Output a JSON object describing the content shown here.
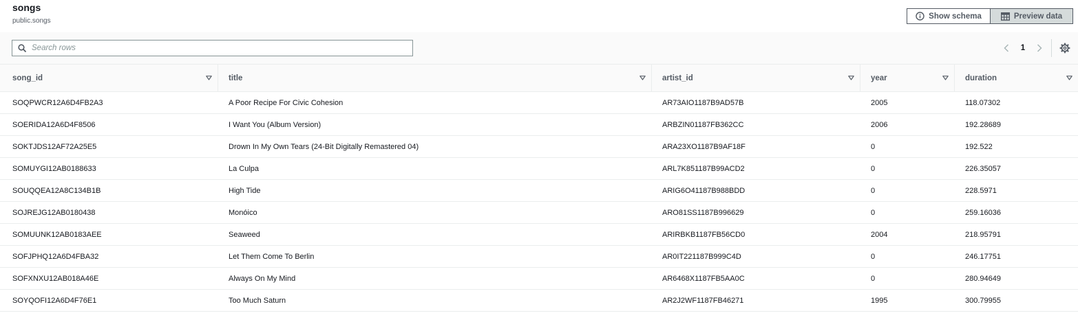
{
  "header": {
    "title": "songs",
    "subtitle": "public.songs",
    "show_schema_label": "Show schema",
    "preview_data_label": "Preview data"
  },
  "toolbar": {
    "search_placeholder": "Search rows",
    "page_number": "1"
  },
  "table": {
    "columns": [
      "song_id",
      "title",
      "artist_id",
      "year",
      "duration"
    ],
    "rows": [
      [
        "SOQPWCR12A6D4FB2A3",
        "A Poor Recipe For Civic Cohesion",
        "AR73AIO1187B9AD57B",
        "2005",
        "118.07302"
      ],
      [
        "SOERIDA12A6D4F8506",
        "I Want You (Album Version)",
        "ARBZIN01187FB362CC",
        "2006",
        "192.28689"
      ],
      [
        "SOKTJDS12AF72A25E5",
        "Drown In My Own Tears (24-Bit Digitally Remastered 04)",
        "ARA23XO1187B9AF18F",
        "0",
        "192.522"
      ],
      [
        "SOMUYGI12AB0188633",
        "La Culpa",
        "ARL7K851187B99ACD2",
        "0",
        "226.35057"
      ],
      [
        "SOUQQEA12A8C134B1B",
        "High Tide",
        "ARIG6O41187B988BDD",
        "0",
        "228.5971"
      ],
      [
        "SOJREJG12AB0180438",
        "Monóico",
        "ARO81SS1187B996629",
        "0",
        "259.16036"
      ],
      [
        "SOMUUNK12AB0183AEE",
        "Seaweed",
        "ARIRBKB1187FB56CD0",
        "2004",
        "218.95791"
      ],
      [
        "SOFJPHQ12A6D4FBA32",
        "Let Them Come To Berlin",
        "AR0IT221187B999C4D",
        "0",
        "246.17751"
      ],
      [
        "SOFXNXU12AB018A46E",
        "Always On My Mind",
        "AR6468X1187FB5AA0C",
        "0",
        "280.94649"
      ],
      [
        "SOYQOFI12A6D4F76E1",
        "Too Much Saturn",
        "AR2J2WF1187FB46271",
        "1995",
        "300.79955"
      ]
    ]
  },
  "icons": {
    "info": "info-icon",
    "table": "table-icon",
    "search": "search-icon",
    "prev": "chevron-left-icon",
    "next": "chevron-right-icon",
    "settings": "gear-icon",
    "sort": "sort-caret-icon"
  },
  "colors": {
    "text": "#16191f",
    "muted": "#545b64",
    "border": "#eaeded",
    "active_button": "#d5dbdb"
  }
}
